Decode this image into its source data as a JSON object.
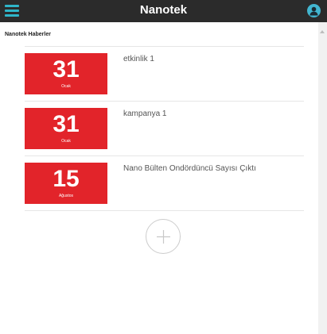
{
  "header": {
    "title": "Nanotek",
    "menu_icon": "hamburger-menu-icon",
    "profile_icon": "user-icon",
    "bar_color": "#2b2b2b",
    "accent_color": "#2fb6c9"
  },
  "section": {
    "title": "Nanotek Haberler"
  },
  "news": [
    {
      "day": "31",
      "month": "Ocak",
      "title": "etkinlik 1"
    },
    {
      "day": "31",
      "month": "Ocak",
      "title": "kampanya 1"
    },
    {
      "day": "15",
      "month": "Ağustos",
      "title": "Nano Bülten Ondördüncü Sayısı Çıktı"
    }
  ],
  "badge_color": "#e2242a",
  "add_button": {
    "icon": "plus-icon"
  }
}
